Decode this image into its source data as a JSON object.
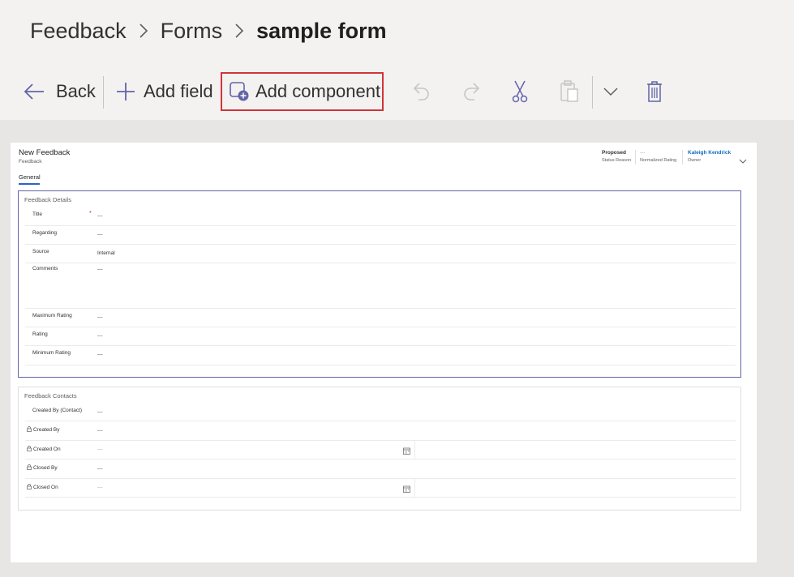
{
  "breadcrumb": {
    "items": [
      "Feedback",
      "Forms"
    ],
    "current": "sample form"
  },
  "toolbar": {
    "back_label": "Back",
    "add_field_label": "Add field",
    "add_component_label": "Add component"
  },
  "form": {
    "title": "New Feedback",
    "subtitle": "Feedback",
    "header_fields": [
      {
        "value": "Proposed",
        "label": "Status Reason"
      },
      {
        "value": "---",
        "label": "Normalized Rating"
      },
      {
        "value": "Kaleigh Kendrick",
        "label": "Owner"
      }
    ],
    "tab": "General",
    "details": {
      "title": "Feedback Details",
      "rows": [
        {
          "label": "Title",
          "value": "---",
          "required": "*"
        },
        {
          "label": "Regarding",
          "value": "---"
        },
        {
          "label": "Source",
          "value": "Internal"
        },
        {
          "label": "Comments",
          "value": "---"
        },
        {
          "label": "Maximum Rating",
          "value": "---"
        },
        {
          "label": "Rating",
          "value": "---"
        },
        {
          "label": "Minimum Rating",
          "value": "---"
        }
      ]
    },
    "contacts": {
      "title": "Feedback Contacts",
      "rows": [
        {
          "label": "Created By (Contact)",
          "value": "---"
        },
        {
          "label": "Created By",
          "value": "---"
        },
        {
          "label": "Created On",
          "value": "---"
        },
        {
          "label": "Closed By",
          "value": "---"
        },
        {
          "label": "Closed On",
          "value": "---"
        }
      ]
    }
  },
  "colors": {
    "accent": "#6264a7",
    "highlight": "#d13438",
    "link": "#0f6cbd"
  }
}
